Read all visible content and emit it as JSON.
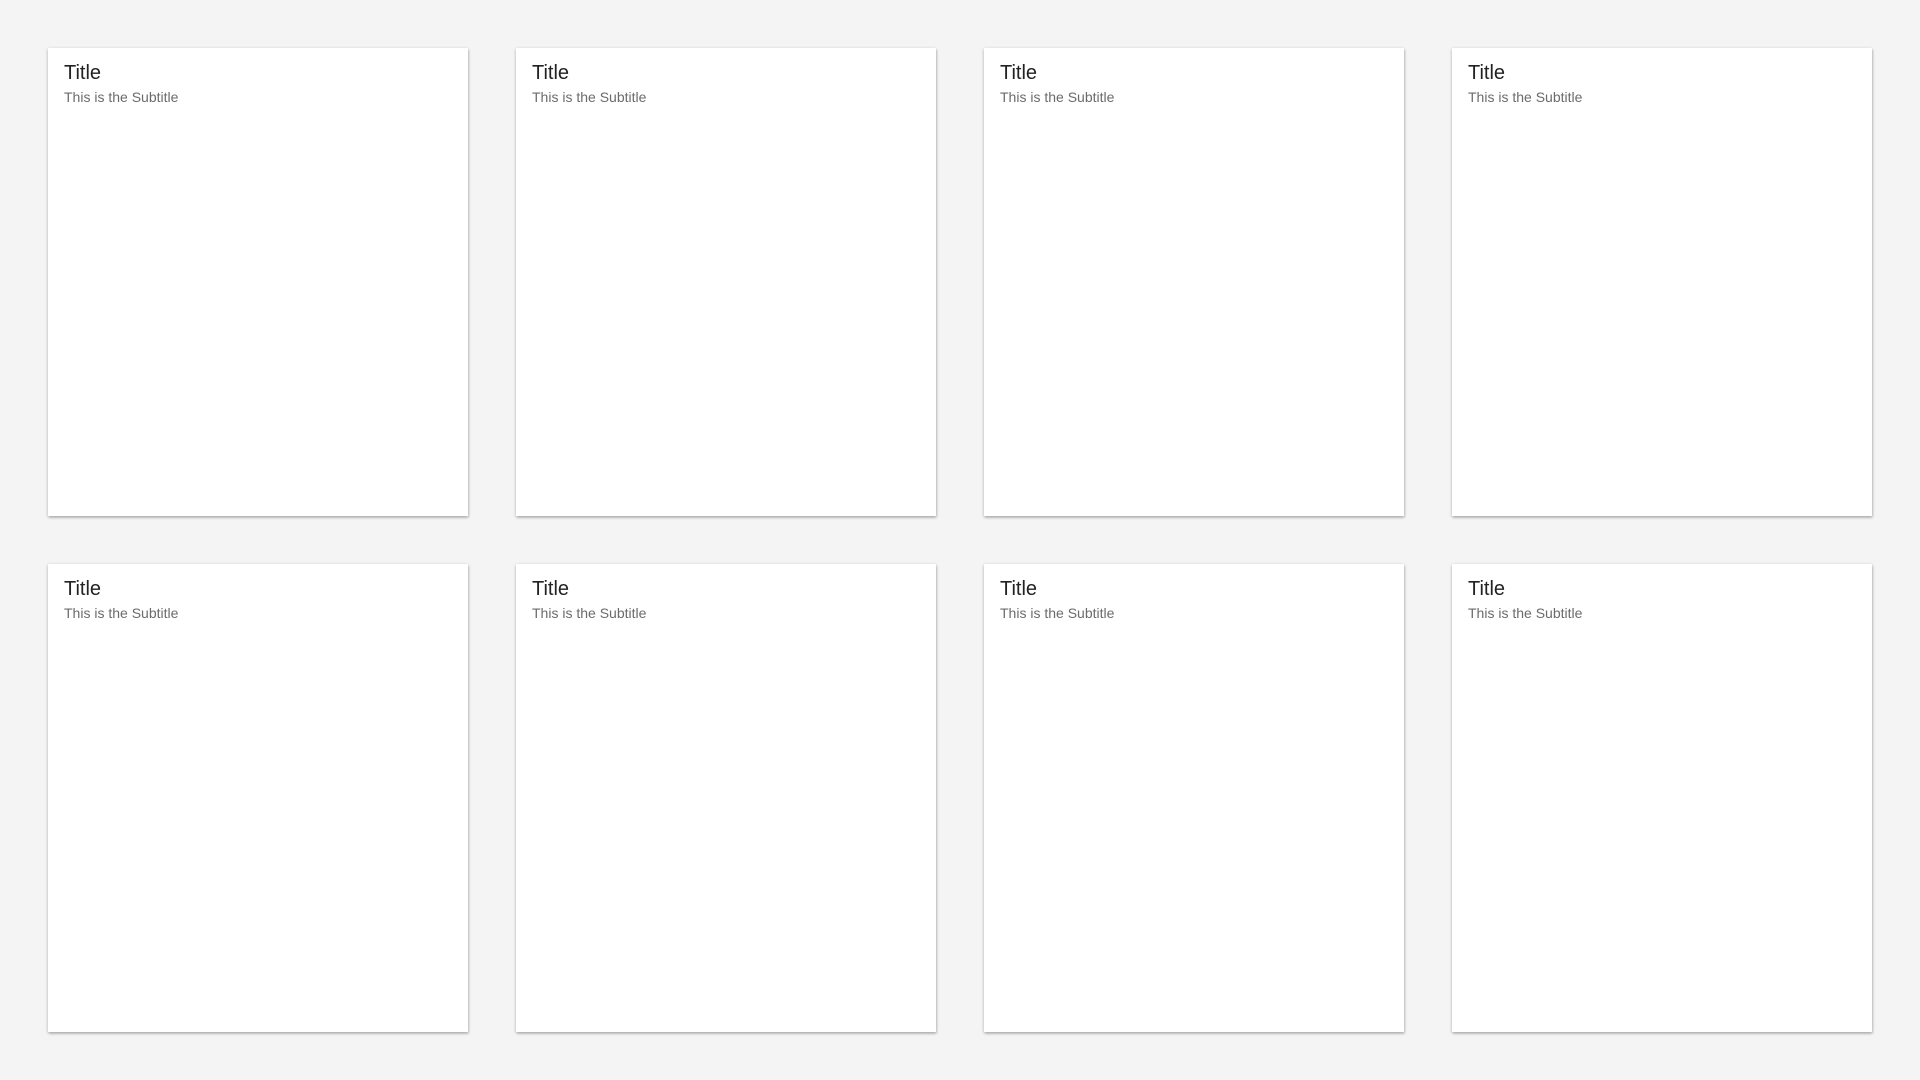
{
  "cards": [
    {
      "title": "Title",
      "subtitle": "This is the Subtitle"
    },
    {
      "title": "Title",
      "subtitle": "This is the Subtitle"
    },
    {
      "title": "Title",
      "subtitle": "This is the Subtitle"
    },
    {
      "title": "Title",
      "subtitle": "This is the Subtitle"
    },
    {
      "title": "Title",
      "subtitle": "This is the Subtitle"
    },
    {
      "title": "Title",
      "subtitle": "This is the Subtitle"
    },
    {
      "title": "Title",
      "subtitle": "This is the Subtitle"
    },
    {
      "title": "Title",
      "subtitle": "This is the Subtitle"
    }
  ],
  "colors": {
    "background": "#f4f4f4",
    "card": "#ffffff",
    "title": "#222222",
    "subtitle": "#6b6b6b"
  }
}
